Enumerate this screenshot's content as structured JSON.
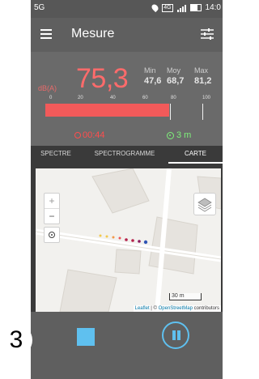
{
  "step_badge": "3",
  "status_bar": {
    "left_icon": "5G",
    "network": "4G",
    "time": "14:0"
  },
  "appbar": {
    "title": "Mesure",
    "menu_icon": "menu-icon",
    "settings_icon": "tune-icon"
  },
  "measure": {
    "unit": "dB(A)",
    "value": "75,3",
    "min_label": "Min",
    "min_value": "47,6",
    "moy_label": "Moy",
    "moy_value": "68,7",
    "max_label": "Max",
    "max_value": "81,2",
    "scale_ticks": [
      "0",
      "20",
      "40",
      "60",
      "80",
      "100"
    ],
    "level_fraction": 0.73,
    "timer": "00:44",
    "distance": "3 m",
    "colors": {
      "value": "#ff6b6b",
      "bar": "#f25a5a",
      "distance": "#7ef07a"
    }
  },
  "tabs": [
    {
      "label": "SPECTRE"
    },
    {
      "label": "SPECTROGRAMME"
    },
    {
      "label": "CARTE",
      "active": true
    }
  ],
  "map": {
    "zoom_in": "+",
    "zoom_out": "−",
    "scale": "30 m",
    "attribution_leaflet": "Leaflet",
    "attribution_sep": " | © ",
    "attribution_osm": "OpenStreetMap",
    "attribution_rest": " contributors"
  },
  "controls": {
    "stop_icon": "stop-icon",
    "pause_icon": "pause-icon",
    "accent": "#5fc0ef"
  }
}
